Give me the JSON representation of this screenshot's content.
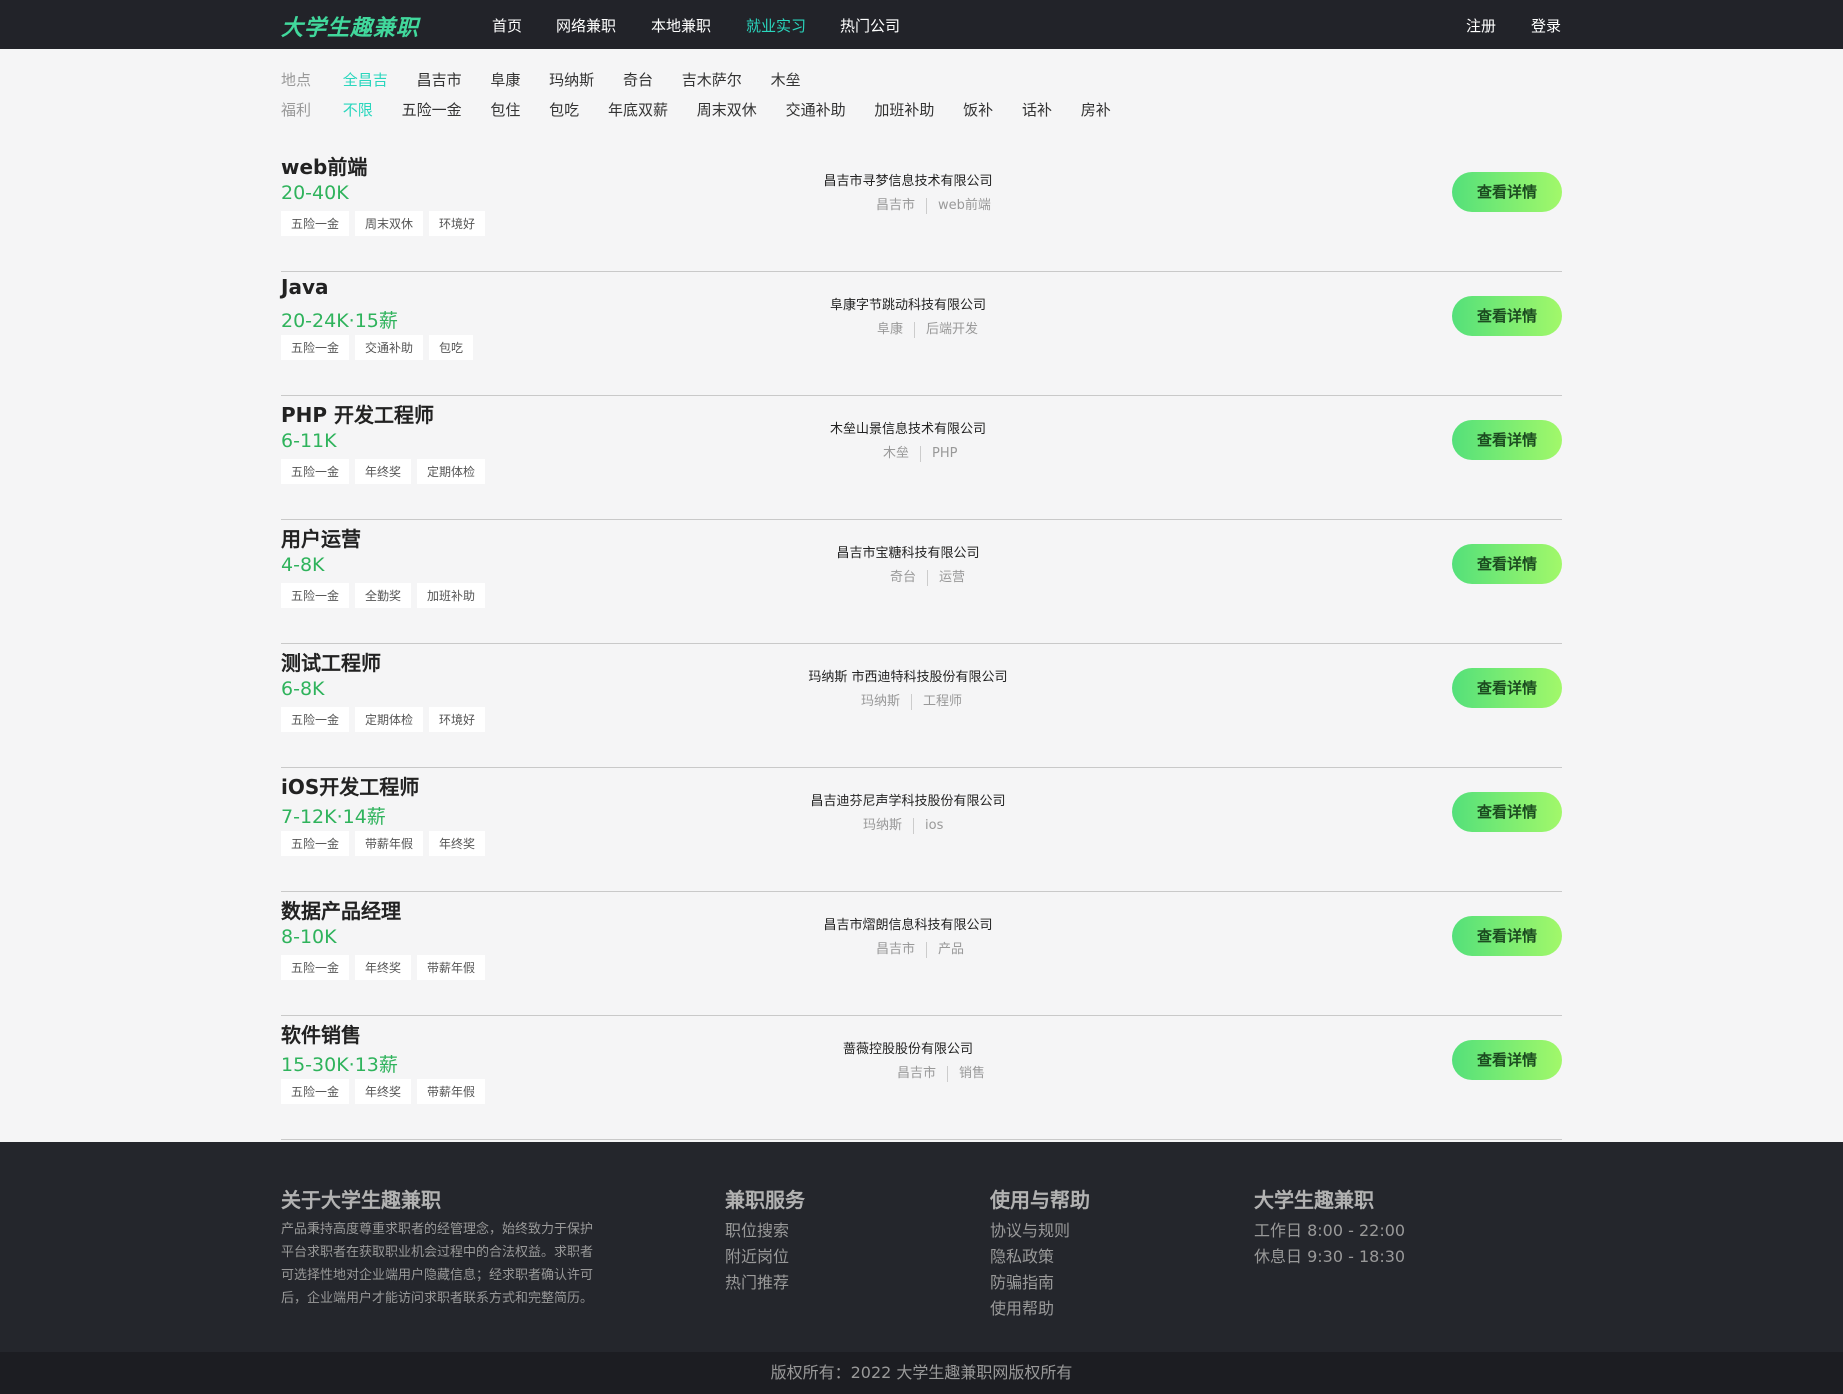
{
  "header": {
    "logo": "大学生趣兼职",
    "nav": [
      "首页",
      "网络兼职",
      "本地兼职",
      "就业实习",
      "热门公司"
    ],
    "active_nav": "就业实习",
    "register": "注册",
    "login": "登录"
  },
  "filters": {
    "location": {
      "label": "地点",
      "options": [
        "全昌吉",
        "昌吉市",
        "阜康",
        "玛纳斯",
        "奇台",
        "吉木萨尔",
        "木垒"
      ],
      "active": "全昌吉"
    },
    "benefits": {
      "label": "福利",
      "options": [
        "不限",
        "五险一金",
        "包住",
        "包吃",
        "年底双薪",
        "周末双休",
        "交通补助",
        "加班补助",
        "饭补",
        "话补",
        "房补"
      ],
      "active": "不限"
    }
  },
  "jobs": [
    {
      "title": "web前端",
      "salary": "20-40K",
      "tags": [
        "五险一金",
        "周末双休",
        "环境好"
      ],
      "company": "昌吉市寻梦信息技术有限公司",
      "location": "昌吉市",
      "category": "web前端",
      "button": "查看详情"
    },
    {
      "title": "Java",
      "salary": "20-24K·15薪",
      "tags": [
        "五险一金",
        "交通补助",
        "包吃"
      ],
      "company": "阜康字节跳动科技有限公司",
      "location": "阜康",
      "category": "后端开发",
      "button": "查看详情"
    },
    {
      "title": "PHP 开发工程师",
      "salary": "6-11K",
      "tags": [
        "五险一金",
        "年终奖",
        "定期体检"
      ],
      "company": "木垒山景信息技术有限公司",
      "location": "木垒",
      "category": "PHP",
      "button": "查看详情"
    },
    {
      "title": "用户运营",
      "salary": "4-8K",
      "tags": [
        "五险一金",
        "全勤奖",
        "加班补助"
      ],
      "company": "昌吉市宝糖科技有限公司",
      "location": "奇台",
      "category": "运营",
      "button": "查看详情"
    },
    {
      "title": "测试工程师",
      "salary": "6-8K",
      "tags": [
        "五险一金",
        "定期体检",
        "环境好"
      ],
      "company": "玛纳斯 市西迪特科技股份有限公司",
      "location": "玛纳斯",
      "category": "工程师",
      "button": "查看详情"
    },
    {
      "title": "iOS开发工程师",
      "salary": "7-12K·14薪",
      "tags": [
        "五险一金",
        "带薪年假",
        "年终奖"
      ],
      "company": "昌吉迪芬尼声学科技股份有限公司",
      "location": "玛纳斯",
      "category": "ios",
      "button": "查看详情"
    },
    {
      "title": "数据产品经理",
      "salary": "8-10K",
      "tags": [
        "五险一金",
        "年终奖",
        "带薪年假"
      ],
      "company": "昌吉市熠朗信息科技有限公司",
      "location": "昌吉市",
      "category": "产品",
      "button": "查看详情"
    },
    {
      "title": "软件销售",
      "salary": "15-30K·13薪",
      "tags": [
        "五险一金",
        "年终奖",
        "带薪年假"
      ],
      "company": "蔷薇控股股份有限公司",
      "location": "昌吉市",
      "category": "销售",
      "button": "查看详情"
    }
  ],
  "footer": {
    "about": {
      "title": "关于大学生趣兼职",
      "text": "产品秉持高度尊重求职者的经管理念，始终致力于保护平台求职者在获取职业机会过程中的合法权益。求职者可选择性地对企业端用户隐藏信息；经求职者确认许可后，企业端用户才能访问求职者联系方式和完整简历。"
    },
    "services": {
      "title": "兼职服务",
      "items": [
        "职位搜索",
        "附近岗位",
        "热门推荐"
      ]
    },
    "help": {
      "title": "使用与帮助",
      "items": [
        "协议与规则",
        "隐私政策",
        "防骗指南",
        "使用帮助"
      ]
    },
    "hours": {
      "title": "大学生趣兼职",
      "items": [
        "工作日 8:00 - 22:00",
        "休息日 9:30 - 18:30"
      ]
    }
  },
  "copyright": "版权所有：2022 大学生趣兼职网版权所有",
  "colors": {
    "accent": "#2ad6bd",
    "salary": "#2fb35c",
    "header_bg": "#222329",
    "footer_bg": "#24262c"
  }
}
